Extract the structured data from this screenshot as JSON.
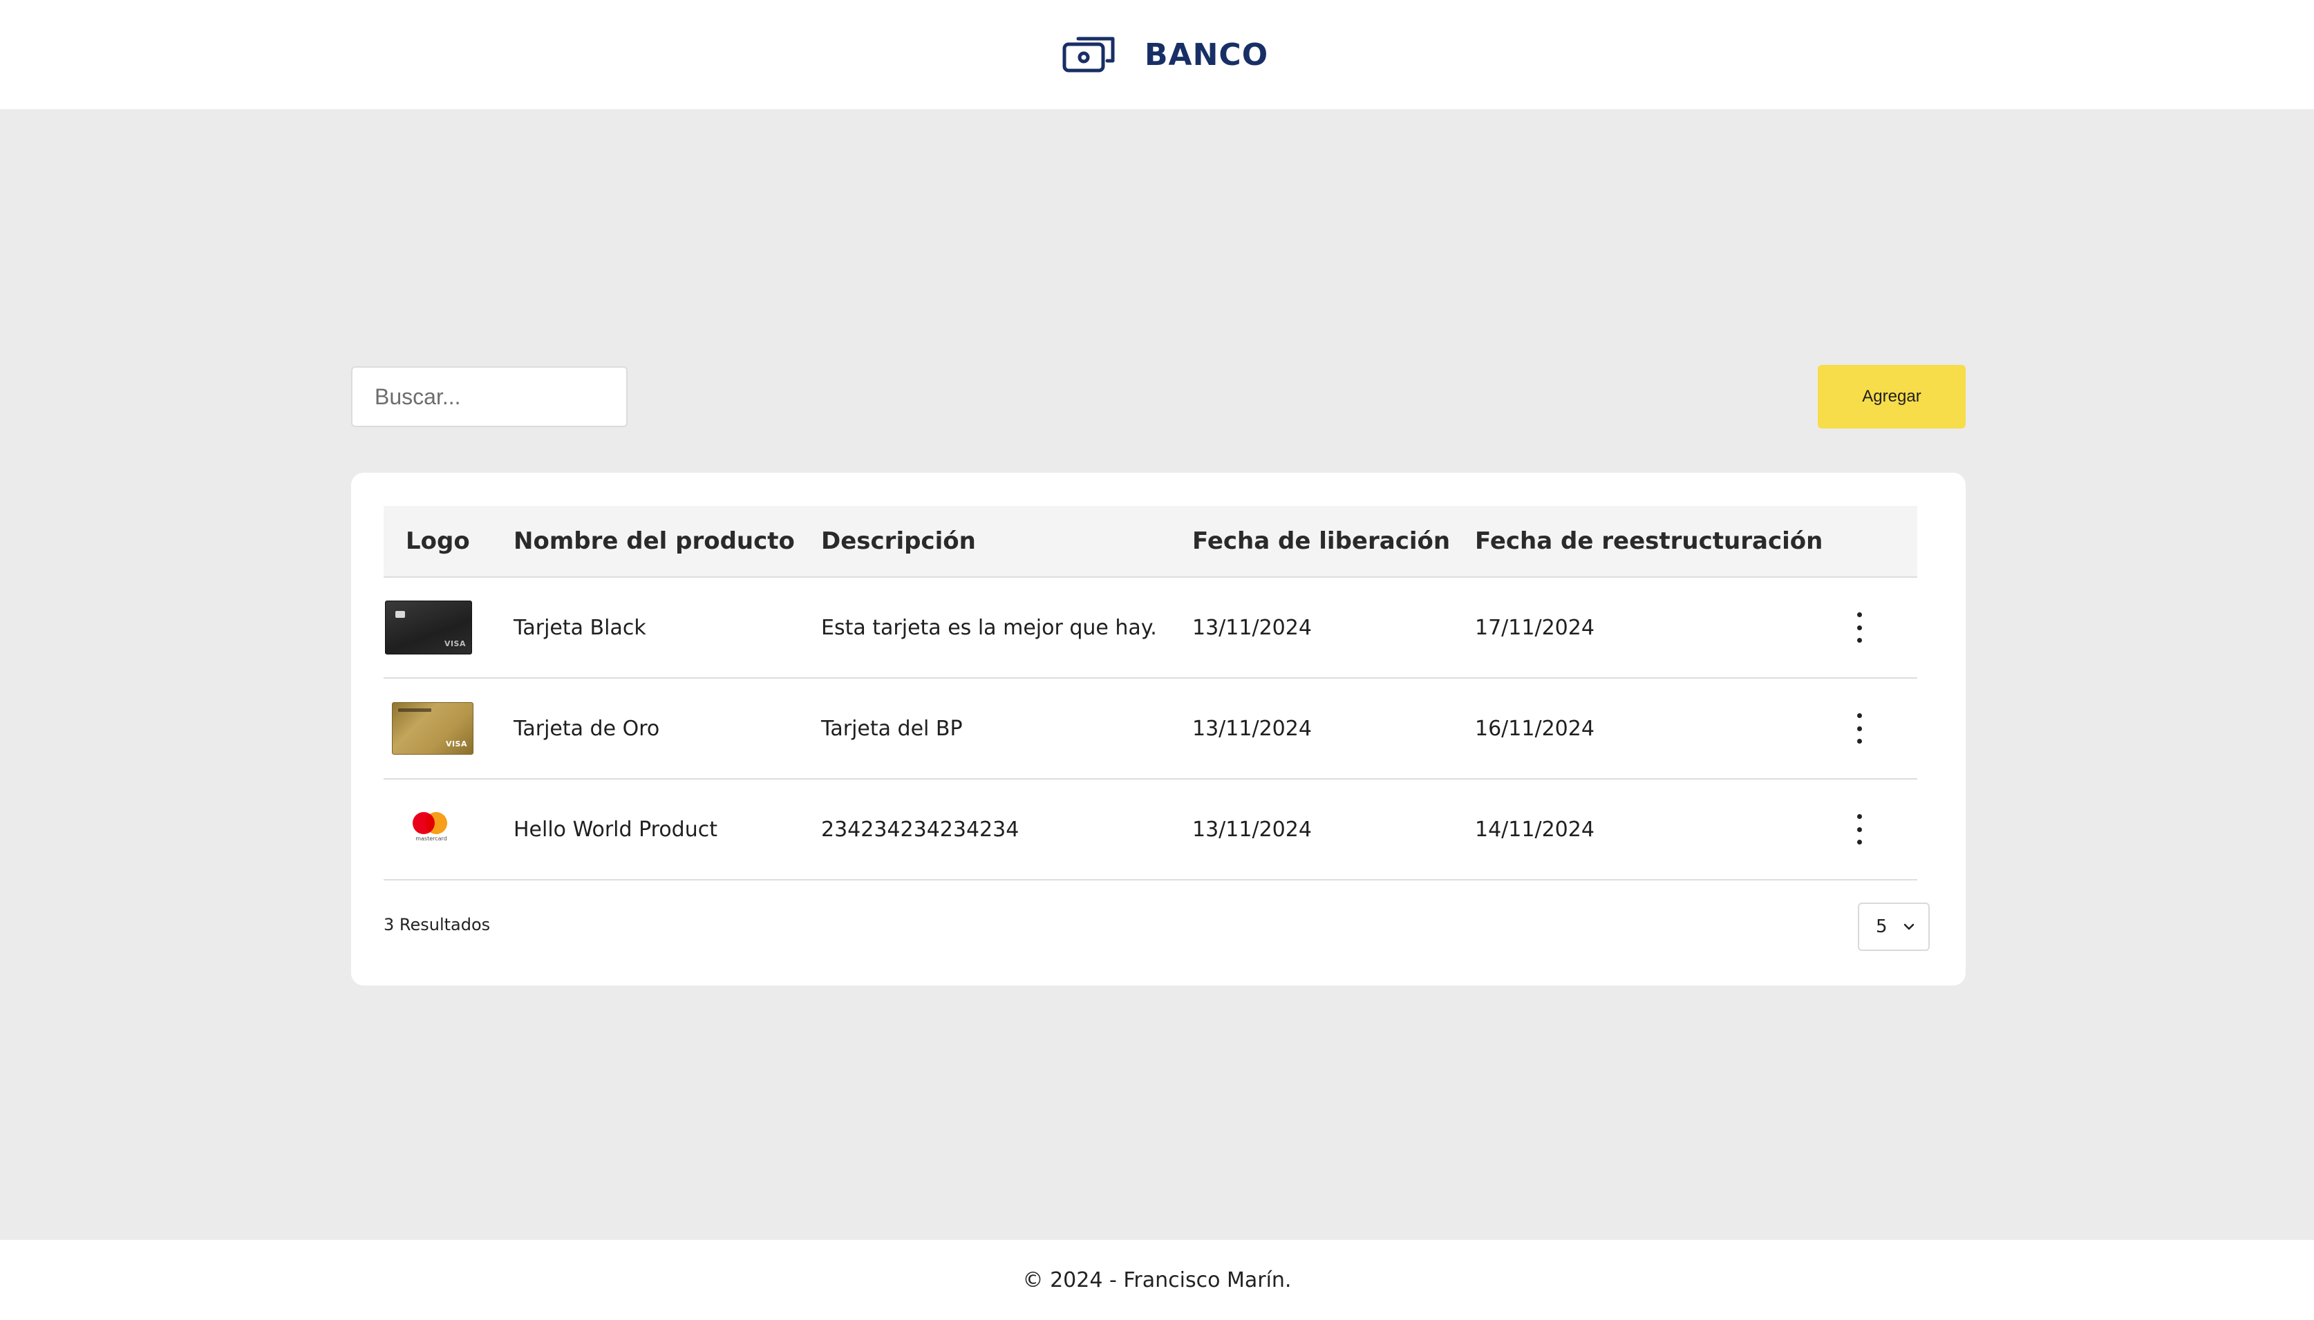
{
  "header": {
    "brand_name": "BANCO",
    "icon": "money-icon",
    "brand_color": "#182f66"
  },
  "toolbar": {
    "search_placeholder": "Buscar...",
    "add_label": "Agregar",
    "add_color": "#f6dd49"
  },
  "table": {
    "columns": [
      "Logo",
      "Nombre del producto",
      "Descripción",
      "Fecha de liberación",
      "Fecha de reestructuración"
    ],
    "rows": [
      {
        "logo": "visa-black-card-logo",
        "name": "Tarjeta Black",
        "description": "Esta tarjeta es la mejor que hay.",
        "release_date": "13/11/2024",
        "restructure_date": "17/11/2024"
      },
      {
        "logo": "visa-gold-card-logo",
        "name": "Tarjeta de Oro",
        "description": "Tarjeta del BP",
        "release_date": "13/11/2024",
        "restructure_date": "16/11/2024"
      },
      {
        "logo": "mastercard-logo",
        "name": "Hello World Product",
        "description": "234234234234234",
        "release_date": "13/11/2024",
        "restructure_date": "14/11/2024"
      }
    ],
    "results_text": "3 Resultados",
    "page_size": "5",
    "menu_icon": "more-vertical-icon"
  },
  "footer": {
    "text": "© 2024 - Francisco Marín."
  }
}
